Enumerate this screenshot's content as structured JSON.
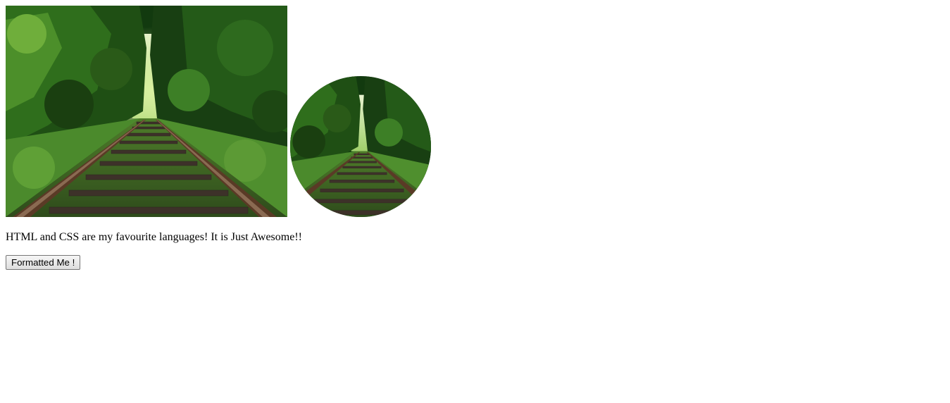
{
  "images": {
    "rectangle": {
      "description_icon": "railway-track-forest-photo"
    },
    "circle": {
      "description_icon": "railway-track-forest-photo-rounded"
    }
  },
  "caption": {
    "text": "HTML and CSS are my favourite languages! It is Just Awesome!!"
  },
  "button": {
    "label": "Formatted Me !"
  },
  "colors": {
    "background": "#ffffff",
    "foliage_dark": "#0d2a0a",
    "foliage_mid": "#2f6e1c",
    "foliage_light": "#8ec63f",
    "rail": "#5a3a26",
    "sleeper": "#3d3129"
  }
}
